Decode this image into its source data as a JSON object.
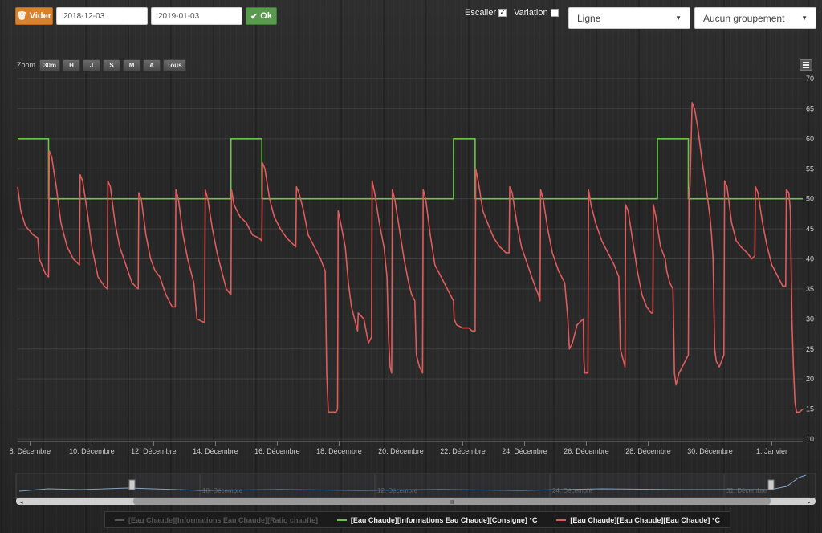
{
  "toolbar": {
    "clear_label": "Vider",
    "start_date": "2018-12-03",
    "end_date": "2019-01-03",
    "ok_label": "Ok",
    "staircase_label": "Escalier",
    "staircase_checked": true,
    "variation_label": "Variation",
    "variation_checked": false,
    "chart_type_selected": "Ligne",
    "grouping_selected": "Aucun groupement"
  },
  "zoom": {
    "label": "Zoom",
    "buttons": [
      "30m",
      "H",
      "J",
      "S",
      "M",
      "A",
      "Tous"
    ]
  },
  "navigator": {
    "labels": [
      "10. Décembre",
      "12. Décembre",
      "24. Décembre",
      "31. Décembre"
    ],
    "scrollbar_grip": "III"
  },
  "legend": {
    "items": [
      {
        "label": "[Eau Chaude][Informations Eau Chaude][Ratio chauffe]",
        "color": "#555555",
        "visible": false
      },
      {
        "label": "[Eau Chaude][Informations Eau Chaude][Consigne] °C",
        "color": "#6ac54a",
        "visible": true
      },
      {
        "label": "[Eau Chaude][Eau Chaude][Eau Chaude] °C",
        "color": "#e05a5a",
        "visible": true
      }
    ]
  },
  "colors": {
    "consigne": "#6ac54a",
    "temperature": "#e05a5a",
    "accent_orange": "#d9822b",
    "ok_green": "#5a9a4f"
  },
  "chart_data": {
    "type": "line",
    "x_unit": "day (December 2018; 32 = 1. Janvier 2019)",
    "x_ticks": [
      {
        "x": 8,
        "label": "8. Décembre"
      },
      {
        "x": 10,
        "label": "10. Décembre"
      },
      {
        "x": 12,
        "label": "12. Décembre"
      },
      {
        "x": 14,
        "label": "14. Décembre"
      },
      {
        "x": 16,
        "label": "16. Décembre"
      },
      {
        "x": 18,
        "label": "18. Décembre"
      },
      {
        "x": 20,
        "label": "20. Décembre"
      },
      {
        "x": 22,
        "label": "22. Décembre"
      },
      {
        "x": 24,
        "label": "24. Décembre"
      },
      {
        "x": 26,
        "label": "26. Décembre"
      },
      {
        "x": 28,
        "label": "28. Décembre"
      },
      {
        "x": 30,
        "label": "30. Décembre"
      },
      {
        "x": 32,
        "label": "1. Janvier"
      }
    ],
    "y_ticks": [
      10,
      15,
      20,
      25,
      30,
      35,
      40,
      45,
      50,
      55,
      60,
      65,
      70
    ],
    "xlim": [
      7.6,
      33.0
    ],
    "ylim": [
      10,
      70
    ],
    "grid": true,
    "series": [
      {
        "name": "[Eau Chaude][Informations Eau Chaude][Consigne] °C",
        "color": "#6ac54a",
        "step": true,
        "points": [
          [
            7.6,
            60
          ],
          [
            8.6,
            60
          ],
          [
            8.6,
            50
          ],
          [
            14.5,
            50
          ],
          [
            14.5,
            60
          ],
          [
            15.5,
            60
          ],
          [
            15.5,
            50
          ],
          [
            21.7,
            50
          ],
          [
            21.7,
            60
          ],
          [
            22.4,
            60
          ],
          [
            22.4,
            50
          ],
          [
            28.3,
            50
          ],
          [
            28.3,
            60
          ],
          [
            29.3,
            60
          ],
          [
            29.3,
            50
          ],
          [
            33.0,
            50
          ]
        ]
      },
      {
        "name": "[Eau Chaude][Eau Chaude][Eau Chaude] °C",
        "color": "#e05a5a",
        "step": false,
        "points": [
          [
            7.6,
            52
          ],
          [
            7.7,
            48
          ],
          [
            7.85,
            45.5
          ],
          [
            8.1,
            44
          ],
          [
            8.25,
            43.5
          ],
          [
            8.3,
            40
          ],
          [
            8.5,
            37.5
          ],
          [
            8.6,
            37
          ],
          [
            8.62,
            58
          ],
          [
            8.7,
            57
          ],
          [
            8.85,
            52
          ],
          [
            9.0,
            46
          ],
          [
            9.2,
            42
          ],
          [
            9.4,
            40
          ],
          [
            9.6,
            39
          ],
          [
            9.62,
            54
          ],
          [
            9.7,
            53
          ],
          [
            9.85,
            48
          ],
          [
            10.0,
            42
          ],
          [
            10.2,
            37
          ],
          [
            10.4,
            35.5
          ],
          [
            10.5,
            35
          ],
          [
            10.52,
            53
          ],
          [
            10.6,
            52
          ],
          [
            10.75,
            46
          ],
          [
            10.9,
            42
          ],
          [
            11.1,
            39
          ],
          [
            11.3,
            36
          ],
          [
            11.5,
            35
          ],
          [
            11.52,
            51
          ],
          [
            11.6,
            50
          ],
          [
            11.75,
            44
          ],
          [
            11.9,
            40
          ],
          [
            12.05,
            38
          ],
          [
            12.2,
            37
          ],
          [
            12.4,
            34
          ],
          [
            12.6,
            32
          ],
          [
            12.7,
            32
          ],
          [
            12.72,
            51.5
          ],
          [
            12.8,
            50
          ],
          [
            12.95,
            44
          ],
          [
            13.1,
            40
          ],
          [
            13.2,
            38
          ],
          [
            13.3,
            36
          ],
          [
            13.4,
            30
          ],
          [
            13.6,
            29.5
          ],
          [
            13.65,
            29.5
          ],
          [
            13.67,
            51.5
          ],
          [
            13.75,
            50
          ],
          [
            13.9,
            45
          ],
          [
            14.05,
            41
          ],
          [
            14.2,
            38
          ],
          [
            14.35,
            35
          ],
          [
            14.5,
            34
          ],
          [
            14.52,
            51.5
          ],
          [
            14.6,
            49
          ],
          [
            14.8,
            47
          ],
          [
            15.0,
            46
          ],
          [
            15.2,
            44
          ],
          [
            15.4,
            43.5
          ],
          [
            15.5,
            43
          ],
          [
            15.52,
            56
          ],
          [
            15.6,
            55
          ],
          [
            15.75,
            50
          ],
          [
            15.9,
            47
          ],
          [
            16.1,
            45
          ],
          [
            16.3,
            43.5
          ],
          [
            16.5,
            42.5
          ],
          [
            16.6,
            42
          ],
          [
            16.62,
            52
          ],
          [
            16.7,
            51
          ],
          [
            16.85,
            48
          ],
          [
            17.0,
            44
          ],
          [
            17.2,
            42
          ],
          [
            17.4,
            40
          ],
          [
            17.55,
            38
          ],
          [
            17.6,
            21
          ],
          [
            17.65,
            14.5
          ],
          [
            17.9,
            14.5
          ],
          [
            17.95,
            15
          ],
          [
            17.97,
            48
          ],
          [
            18.05,
            46
          ],
          [
            18.2,
            42
          ],
          [
            18.3,
            36
          ],
          [
            18.4,
            32
          ],
          [
            18.5,
            30
          ],
          [
            18.6,
            28
          ],
          [
            18.62,
            31
          ],
          [
            18.8,
            30
          ],
          [
            18.95,
            26
          ],
          [
            19.05,
            27
          ],
          [
            19.07,
            53
          ],
          [
            19.15,
            51
          ],
          [
            19.3,
            46
          ],
          [
            19.45,
            42
          ],
          [
            19.55,
            37
          ],
          [
            19.6,
            27
          ],
          [
            19.65,
            22
          ],
          [
            19.7,
            21
          ],
          [
            19.72,
            51.5
          ],
          [
            19.8,
            50
          ],
          [
            19.95,
            45
          ],
          [
            20.1,
            40
          ],
          [
            20.25,
            36
          ],
          [
            20.35,
            34
          ],
          [
            20.45,
            33
          ],
          [
            20.5,
            24
          ],
          [
            20.6,
            22
          ],
          [
            20.7,
            21
          ],
          [
            20.72,
            51.5
          ],
          [
            20.8,
            50
          ],
          [
            20.95,
            44
          ],
          [
            21.1,
            39
          ],
          [
            21.3,
            37
          ],
          [
            21.5,
            35
          ],
          [
            21.7,
            33
          ],
          [
            21.72,
            30
          ],
          [
            21.8,
            29
          ],
          [
            22.0,
            28.5
          ],
          [
            22.2,
            28.5
          ],
          [
            22.3,
            28
          ],
          [
            22.4,
            28
          ],
          [
            22.42,
            55
          ],
          [
            22.5,
            53
          ],
          [
            22.65,
            48
          ],
          [
            22.8,
            46
          ],
          [
            23.0,
            43.5
          ],
          [
            23.2,
            42
          ],
          [
            23.4,
            41
          ],
          [
            23.5,
            41
          ],
          [
            23.52,
            52
          ],
          [
            23.6,
            51
          ],
          [
            23.75,
            46
          ],
          [
            23.9,
            42
          ],
          [
            24.1,
            39
          ],
          [
            24.3,
            36
          ],
          [
            24.45,
            34
          ],
          [
            24.5,
            33
          ],
          [
            24.52,
            51.5
          ],
          [
            24.6,
            50
          ],
          [
            24.75,
            45
          ],
          [
            24.9,
            41
          ],
          [
            25.1,
            38
          ],
          [
            25.3,
            36
          ],
          [
            25.4,
            30
          ],
          [
            25.45,
            25
          ],
          [
            25.55,
            26
          ],
          [
            25.7,
            29
          ],
          [
            25.9,
            30
          ],
          [
            25.92,
            23
          ],
          [
            25.95,
            21
          ],
          [
            26.05,
            21
          ],
          [
            26.07,
            51.5
          ],
          [
            26.15,
            49
          ],
          [
            26.3,
            46
          ],
          [
            26.5,
            43
          ],
          [
            26.7,
            41
          ],
          [
            26.9,
            39
          ],
          [
            27.05,
            37
          ],
          [
            27.1,
            25
          ],
          [
            27.2,
            23
          ],
          [
            27.25,
            22
          ],
          [
            27.27,
            49
          ],
          [
            27.35,
            48
          ],
          [
            27.5,
            43
          ],
          [
            27.65,
            38
          ],
          [
            27.8,
            34
          ],
          [
            27.95,
            32
          ],
          [
            28.1,
            31
          ],
          [
            28.15,
            31
          ],
          [
            28.17,
            49
          ],
          [
            28.25,
            47
          ],
          [
            28.4,
            42
          ],
          [
            28.55,
            40
          ],
          [
            28.6,
            38
          ],
          [
            28.7,
            36
          ],
          [
            28.8,
            35
          ],
          [
            28.85,
            21
          ],
          [
            28.9,
            19
          ],
          [
            29.0,
            21
          ],
          [
            29.2,
            23
          ],
          [
            29.3,
            24
          ],
          [
            29.32,
            51.5
          ],
          [
            29.35,
            52
          ],
          [
            29.42,
            66
          ],
          [
            29.5,
            65
          ],
          [
            29.6,
            62
          ],
          [
            29.75,
            56
          ],
          [
            29.9,
            51
          ],
          [
            30.0,
            47
          ],
          [
            30.05,
            44
          ],
          [
            30.1,
            40
          ],
          [
            30.15,
            25
          ],
          [
            30.2,
            23
          ],
          [
            30.3,
            22
          ],
          [
            30.45,
            24
          ],
          [
            30.47,
            53
          ],
          [
            30.55,
            52
          ],
          [
            30.7,
            46
          ],
          [
            30.85,
            43
          ],
          [
            31.0,
            42
          ],
          [
            31.2,
            41
          ],
          [
            31.35,
            40
          ],
          [
            31.45,
            40.5
          ],
          [
            31.47,
            52
          ],
          [
            31.55,
            51
          ],
          [
            31.7,
            46
          ],
          [
            31.85,
            42
          ],
          [
            32.0,
            39
          ],
          [
            32.2,
            37
          ],
          [
            32.35,
            35.5
          ],
          [
            32.45,
            35.5
          ],
          [
            32.47,
            51.5
          ],
          [
            32.55,
            51
          ],
          [
            32.6,
            48
          ],
          [
            32.65,
            30
          ],
          [
            32.7,
            22
          ],
          [
            32.75,
            16
          ],
          [
            32.8,
            14.5
          ],
          [
            32.9,
            14.5
          ],
          [
            33.0,
            15
          ]
        ]
      }
    ]
  }
}
